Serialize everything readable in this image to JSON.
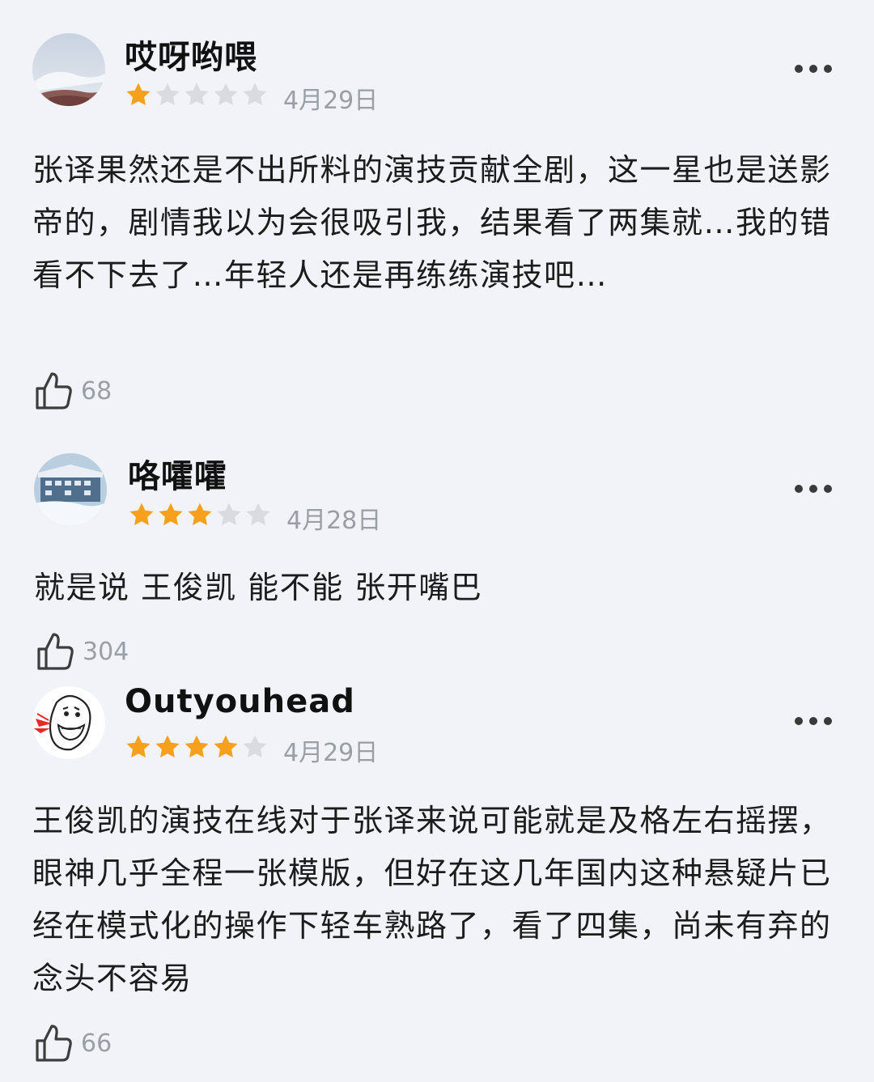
{
  "reviews": [
    {
      "username": "哎呀哟喂",
      "rating": 1,
      "max_rating": 5,
      "date": "4月29日",
      "content": "张译果然还是不出所料的演技贡献全剧，这一星也是送影帝的，剧情我以为会很吸引我，结果看了两集就…我的错 看不下去了…年轻人还是再练练演技吧…",
      "likes": "68"
    },
    {
      "username": "咯嚯嚯",
      "rating": 3,
      "max_rating": 5,
      "date": "4月28日",
      "content": "就是说 王俊凯 能不能 张开嘴巴",
      "likes": "304"
    },
    {
      "username": "Outyouhead",
      "rating": 4,
      "max_rating": 5,
      "date": "4月29日",
      "content": "王俊凯的演技在线对于张译来说可能就是及格左右摇摆，眼神几乎全程一张模版，但好在这几年国内这种悬疑片已经在模式化的操作下轻车熟路了，看了四集，尚未有弃的念头不容易",
      "likes": "66"
    }
  ],
  "colors": {
    "star_filled": "#f7a01c",
    "star_empty": "#d9dbe0",
    "secondary_text": "#9a9ea6",
    "background": "#f1f3f8"
  },
  "icons": {
    "like": "thumbs-up-icon",
    "more": "more-dots-icon",
    "star": "star-icon"
  }
}
